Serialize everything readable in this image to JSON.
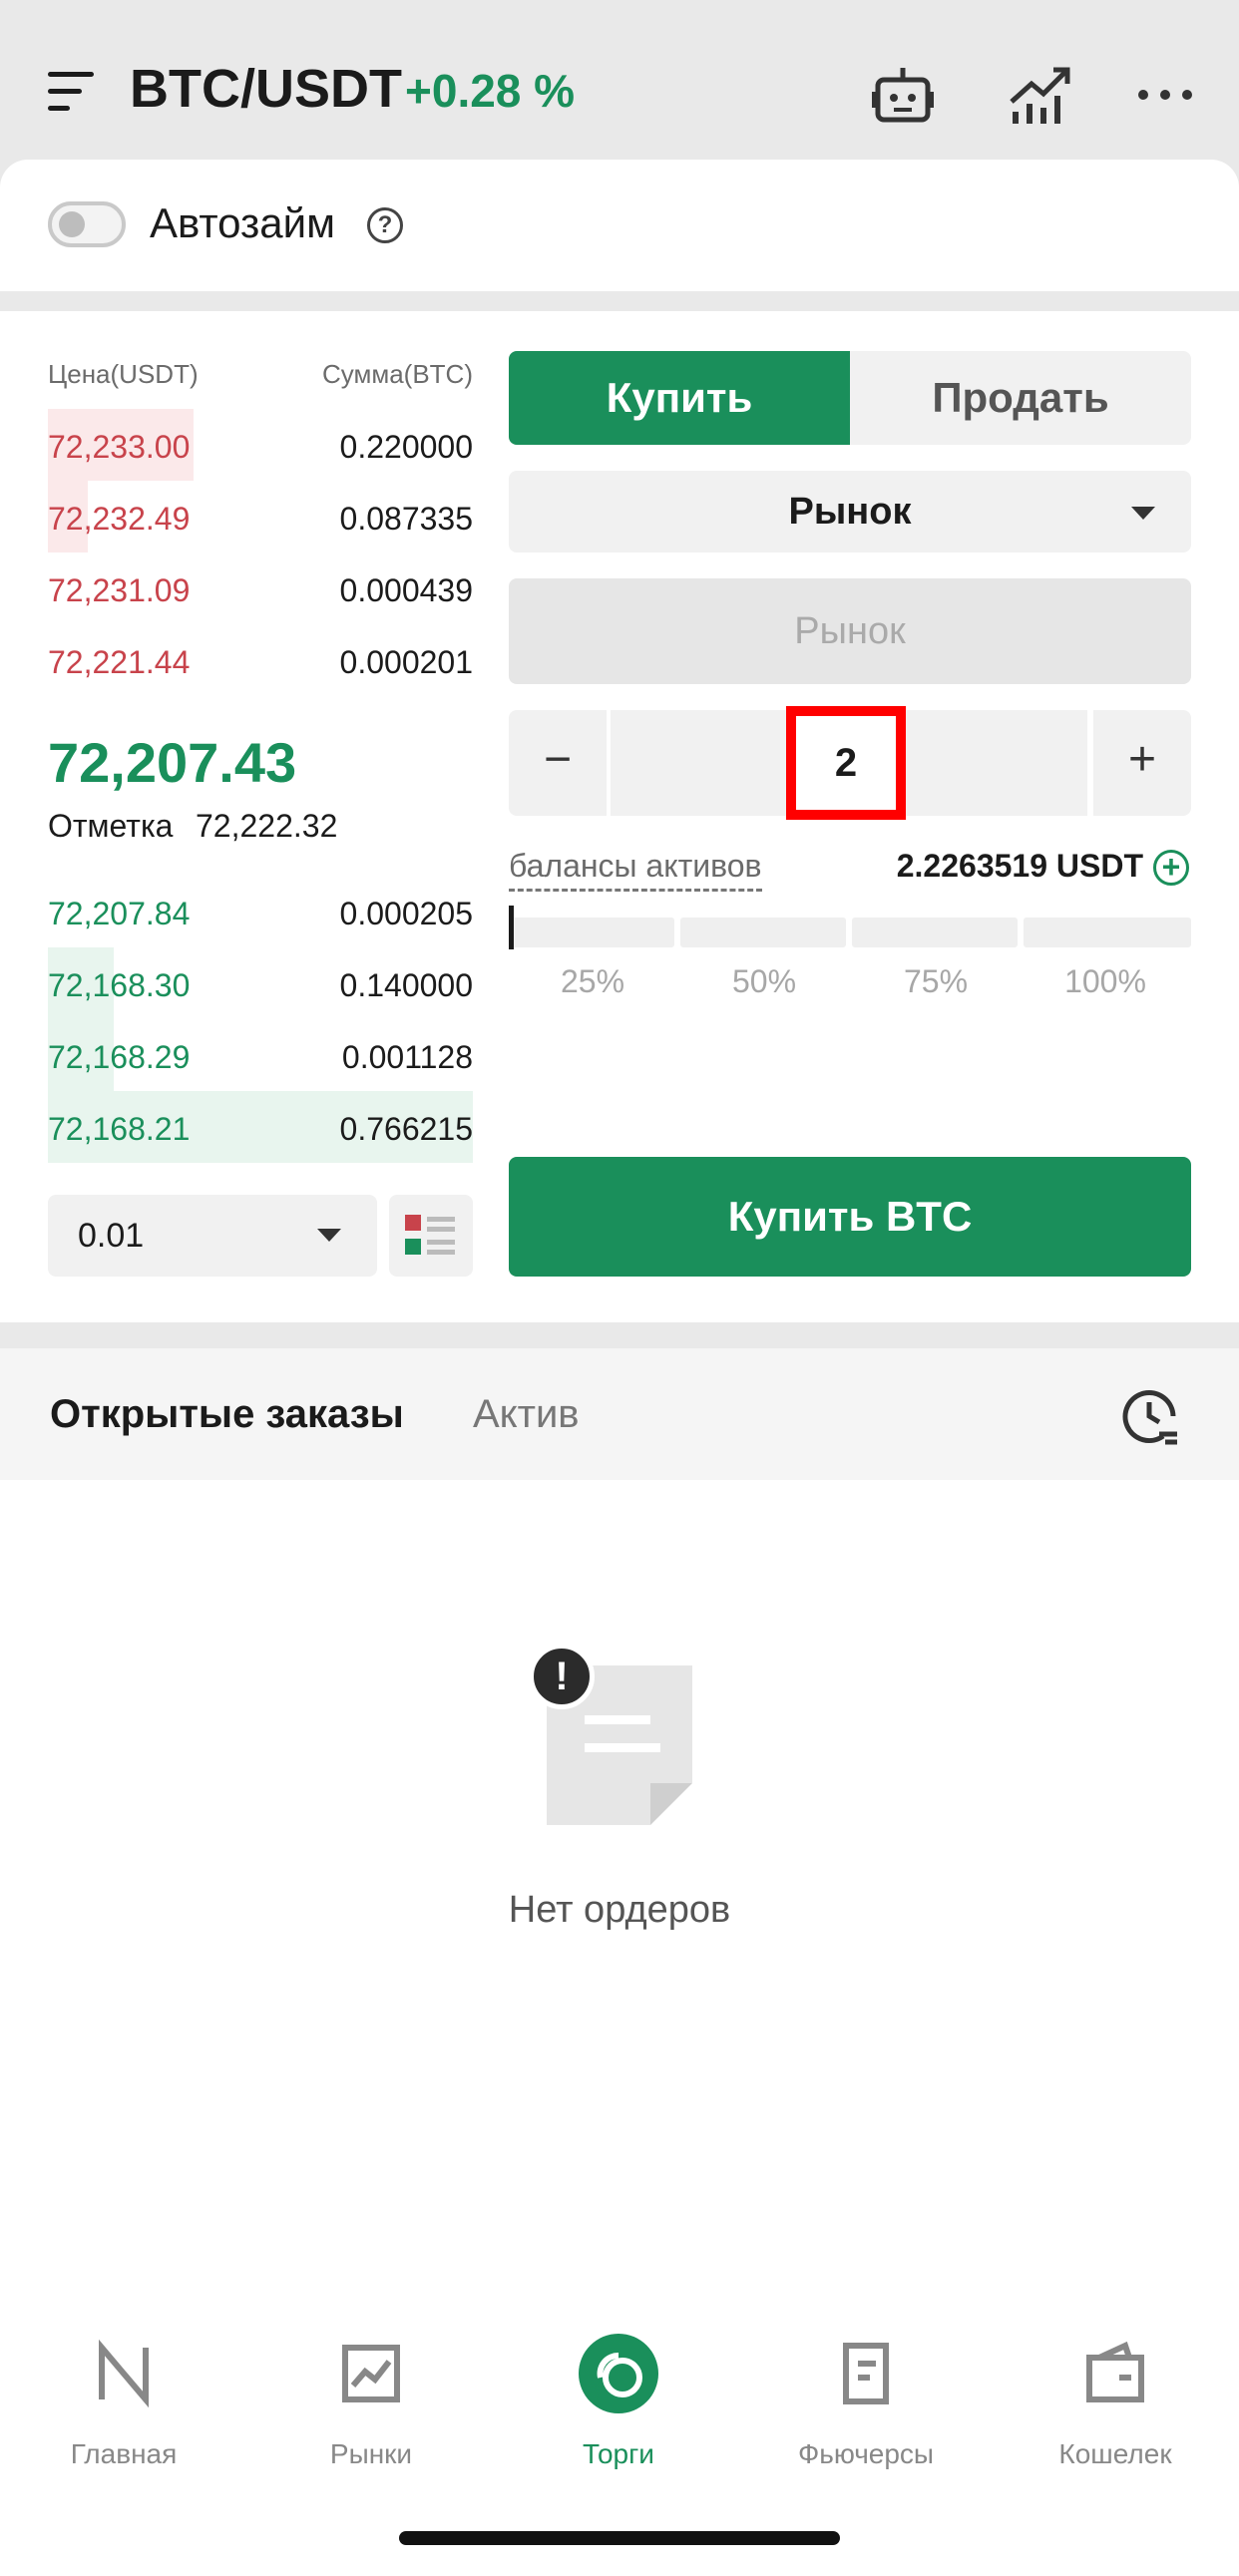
{
  "header": {
    "pair": "BTC/USDT",
    "change": "+0.28 %",
    "icons": [
      "menu-icon",
      "robot-icon",
      "chart-icon",
      "more-icon"
    ]
  },
  "autoloan": {
    "label": "Автозайм",
    "help": "?"
  },
  "orderbook": {
    "price_header": "Цена(USDT)",
    "amount_header": "Сумма(BTC)",
    "asks": [
      {
        "price": "72,233.00",
        "amount": "0.220000"
      },
      {
        "price": "72,232.49",
        "amount": "0.087335"
      },
      {
        "price": "72,231.09",
        "amount": "0.000439"
      },
      {
        "price": "72,221.44",
        "amount": "0.000201"
      }
    ],
    "last_price": "72,207.43",
    "mark_label": "Отметка",
    "mark_value": "72,222.32",
    "bids": [
      {
        "price": "72,207.84",
        "amount": "0.000205"
      },
      {
        "price": "72,168.30",
        "amount": "0.140000"
      },
      {
        "price": "72,168.29",
        "amount": "0.001128"
      },
      {
        "price": "72,168.21",
        "amount": "0.766215"
      }
    ],
    "precision": "0.01"
  },
  "order_form": {
    "buy_tab": "Купить",
    "sell_tab": "Продать",
    "order_type": "Рынок",
    "price_placeholder": "Рынок",
    "quantity": "2",
    "minus": "−",
    "plus": "+",
    "balance_label": "балансы активов",
    "balance_value": "2.2263519 USDT",
    "percentages": [
      "25%",
      "50%",
      "75%",
      "100%"
    ],
    "slider_fraction": 0,
    "submit": "Купить BTC",
    "colors": {
      "buy": "#1a8f5b",
      "ask": "#c8434b"
    }
  },
  "orders": {
    "tab_open": "Открытые заказы",
    "tab_asset": "Актив",
    "empty_text": "Нет ордеров"
  },
  "nav": {
    "items": [
      {
        "label": "Главная",
        "icon": "home-icon"
      },
      {
        "label": "Рынки",
        "icon": "markets-icon"
      },
      {
        "label": "Торги",
        "icon": "trade-icon"
      },
      {
        "label": "Фьючерсы",
        "icon": "futures-icon"
      },
      {
        "label": "Кошелек",
        "icon": "wallet-icon"
      }
    ],
    "active": "Торги"
  }
}
